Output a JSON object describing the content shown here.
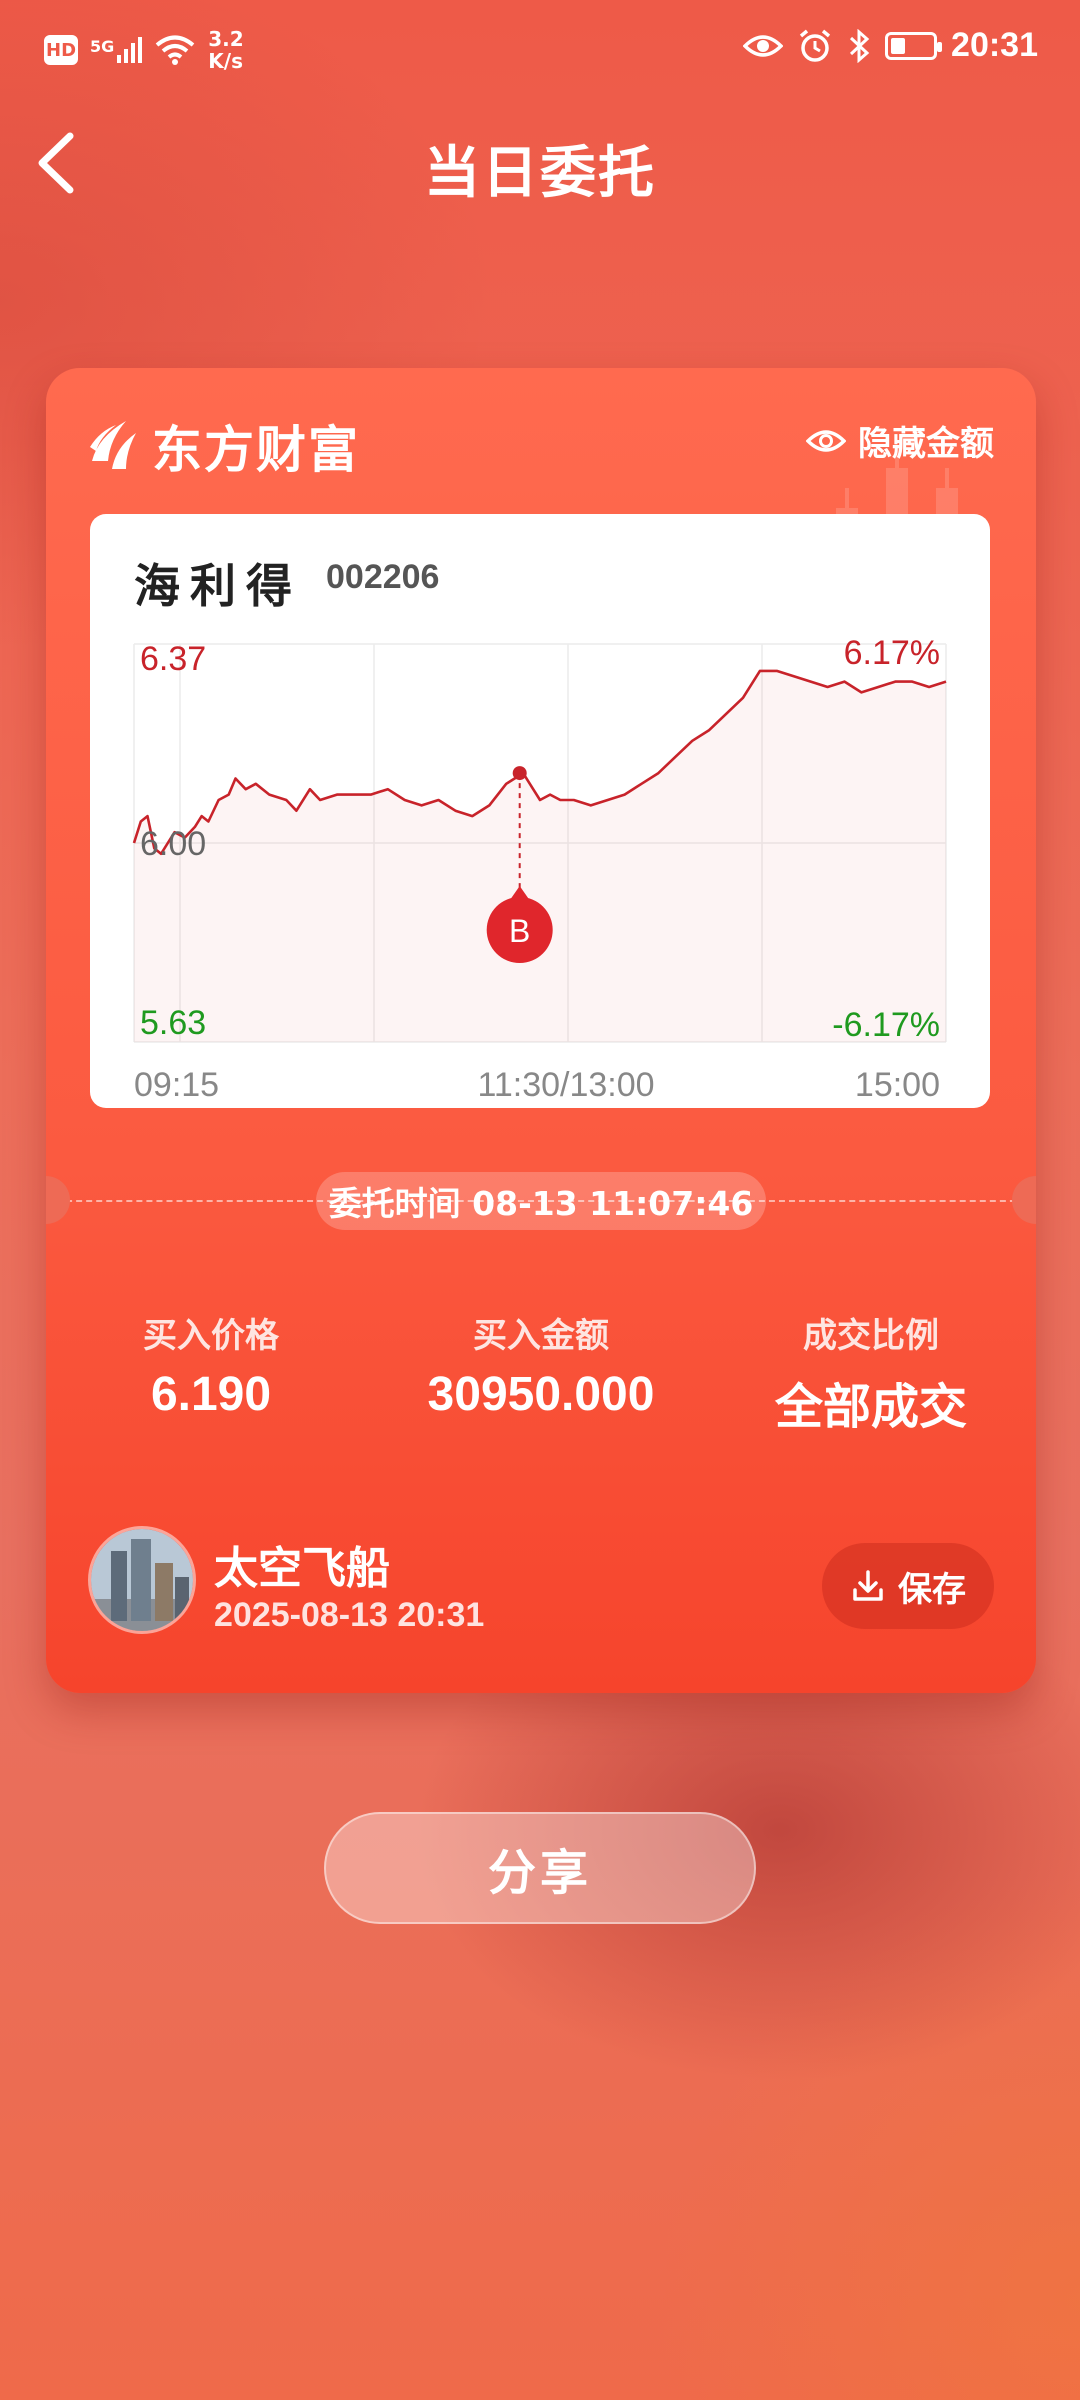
{
  "status_bar": {
    "hd": "HD",
    "network": "5G",
    "net_speed_value": "3.2",
    "net_speed_unit": "K/s",
    "time": "20:31",
    "icons": [
      "eye-icon",
      "alarm-icon",
      "bluetooth-icon",
      "battery-icon"
    ]
  },
  "header": {
    "title": "当日委托",
    "back_icon": "chevron-left-icon"
  },
  "card": {
    "brand_name": "东方财富",
    "hide_amount_label": "隐藏金额",
    "stock": {
      "name": "海利得",
      "code": "002206"
    },
    "order_time_label": "委托时间 08-13 11:07:46",
    "stats": [
      {
        "label": "买入价格",
        "value": "6.190"
      },
      {
        "label": "买入金额",
        "value": "30950.000"
      },
      {
        "label": "成交比例",
        "value": "全部成交"
      }
    ],
    "user": {
      "name": "太空飞船",
      "time": "2025-08-13 20:31"
    },
    "save_label": "保存"
  },
  "share_label": "分享",
  "colors": {
    "accent": "#f6442c",
    "up_red": "#c8232a",
    "down_green": "#1f9a1f"
  },
  "chart_data": {
    "type": "line",
    "title": "",
    "x_tick_labels": [
      "09:15",
      "11:30/13:00",
      "15:00"
    ],
    "y_tick_labels": [
      "6.37",
      "6.00",
      "5.63"
    ],
    "pct_labels": [
      "6.17%",
      "-6.17%"
    ],
    "ylim": [
      5.63,
      6.37
    ],
    "base_price": 6.0,
    "series": [
      {
        "points_minutes": [
          0,
          2,
          4,
          6,
          8,
          10,
          12,
          15,
          18,
          20,
          22,
          25,
          28,
          30,
          33,
          36,
          40,
          45,
          48,
          52,
          55,
          60,
          65,
          70,
          75,
          80,
          85,
          90,
          95,
          100,
          105,
          110,
          115,
          118,
          120,
          123,
          126,
          130,
          135,
          140,
          145,
          150,
          155,
          160,
          165,
          170,
          175,
          180,
          185,
          190,
          195,
          200,
          205,
          210,
          215,
          220,
          225,
          230,
          235,
          240
        ],
        "values": [
          6.0,
          6.04,
          6.05,
          5.99,
          5.98,
          6.0,
          6.02,
          6.01,
          6.03,
          6.05,
          6.04,
          6.08,
          6.09,
          6.12,
          6.1,
          6.11,
          6.09,
          6.08,
          6.06,
          6.1,
          6.08,
          6.09,
          6.09,
          6.09,
          6.1,
          6.08,
          6.07,
          6.08,
          6.06,
          6.05,
          6.07,
          6.11,
          6.13,
          6.1,
          6.08,
          6.09,
          6.08,
          6.08,
          6.07,
          6.08,
          6.09,
          6.11,
          6.13,
          6.16,
          6.19,
          6.21,
          6.24,
          6.27,
          6.32,
          6.32,
          6.31,
          6.3,
          6.29,
          6.3,
          6.28,
          6.29,
          6.3,
          6.3,
          6.29,
          6.3
        ]
      }
    ],
    "buy_marker": {
      "label": "B",
      "time_minutes": 114,
      "price": 6.13
    },
    "grid": true
  }
}
